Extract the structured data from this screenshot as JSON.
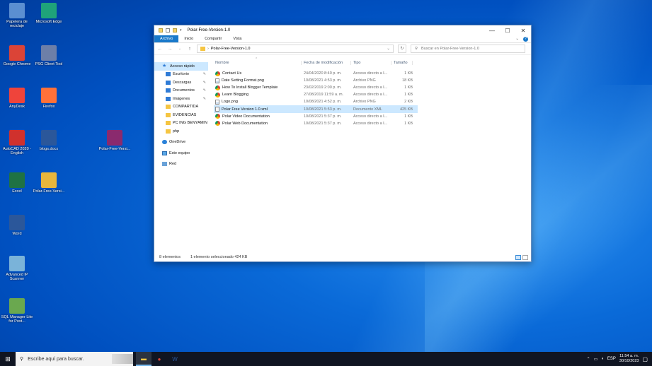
{
  "desktop": {
    "icons": [
      {
        "label": "Papelera de reciclaje",
        "icon": "recycle-bin-icon",
        "color": "#5b8fd1"
      },
      {
        "label": "Microsoft Edge",
        "icon": "edge-icon",
        "color": "#1fa37a"
      },
      {
        "label": "Google Chrome",
        "icon": "chrome-icon",
        "color": "#db4437"
      },
      {
        "label": "PSG Client Tool",
        "icon": "app-icon",
        "color": "#6d7fa8"
      },
      {
        "label": "AnyDesk",
        "icon": "anydesk-icon",
        "color": "#ef443b"
      },
      {
        "label": "Firefox",
        "icon": "firefox-icon",
        "color": "#ff7139"
      },
      {
        "label": "AutoCAD 2020 - English",
        "icon": "autocad-icon",
        "color": "#d0312d"
      },
      {
        "label": "blogs.docx",
        "icon": "word-icon",
        "color": "#2b579a"
      },
      {
        "label": "Polar-Free-Versi...",
        "icon": "winrar-icon",
        "color": "#8a2a6e"
      },
      {
        "label": "Excel",
        "icon": "excel-icon",
        "color": "#1f7244"
      },
      {
        "label": "Polar-Free-Versi...",
        "icon": "zip-folder-icon",
        "color": "#e8b63c"
      },
      {
        "label": "Word",
        "icon": "word-icon",
        "color": "#2b579a"
      },
      {
        "label": "Advanced IP Scanner",
        "icon": "network-icon",
        "color": "#7ab3d9"
      },
      {
        "label": "SQL Manager Lite for Post...",
        "icon": "database-icon",
        "color": "#6aa84f"
      }
    ]
  },
  "window": {
    "title": "Polar-Free-Version-1.0",
    "controls": {
      "minimize": "—",
      "maximize": "☐",
      "close": "✕"
    },
    "ribbon_tabs": [
      "Archivo",
      "Inicio",
      "Compartir",
      "Vista"
    ],
    "address": "Polar-Free-Version-1.0",
    "search_placeholder": "Buscar en Polar-Free-Version-1.0",
    "nav_items": [
      {
        "label": "Acceso rápido",
        "icon": "star-icon",
        "kind": "star",
        "pinned": false
      },
      {
        "label": "Escritorio",
        "icon": "desktop-folder-icon",
        "kind": "blue",
        "pinned": true
      },
      {
        "label": "Descargas",
        "icon": "downloads-icon",
        "kind": "blue",
        "pinned": true
      },
      {
        "label": "Documentos",
        "icon": "documents-icon",
        "kind": "blue",
        "pinned": true
      },
      {
        "label": "Imágenes",
        "icon": "pictures-icon",
        "kind": "blue",
        "pinned": true
      },
      {
        "label": "COMPARTIDA",
        "icon": "folder-icon",
        "kind": "yellow",
        "pinned": false
      },
      {
        "label": "EVIDENCIAS",
        "icon": "folder-icon",
        "kind": "yellow",
        "pinned": false
      },
      {
        "label": "PC ING BENYAMIN",
        "icon": "folder-icon",
        "kind": "yellow",
        "pinned": false
      },
      {
        "label": "php",
        "icon": "folder-icon",
        "kind": "yellow",
        "pinned": false
      },
      {
        "label": "OneDrive",
        "icon": "onedrive-icon",
        "kind": "cloud",
        "pinned": false
      },
      {
        "label": "Este equipo",
        "icon": "this-pc-icon",
        "kind": "pc",
        "pinned": false
      },
      {
        "label": "Red",
        "icon": "network-icon",
        "kind": "net",
        "pinned": false
      }
    ],
    "columns": {
      "name": "Nombre",
      "date": "Fecha de modificación",
      "type": "Tipo",
      "size": "Tamaño"
    },
    "files": [
      {
        "name": "Contact Us",
        "date": "24/04/2020 8:40 p. m.",
        "type": "Acceso directo a I...",
        "size": "1 KB",
        "icon": "link",
        "selected": false
      },
      {
        "name": "Date Setting Format.png",
        "date": "10/08/2021 4:53 p. m.",
        "type": "Archivo PNG",
        "size": "18 KB",
        "icon": "png",
        "selected": false
      },
      {
        "name": "How To Install Blogger Template",
        "date": "23/02/2019 2:00 p. m.",
        "type": "Acceso directo a I...",
        "size": "1 KB",
        "icon": "link",
        "selected": false
      },
      {
        "name": "Learn Blogging",
        "date": "27/08/2019 11:59 a. m.",
        "type": "Acceso directo a I...",
        "size": "1 KB",
        "icon": "link",
        "selected": false
      },
      {
        "name": "Logo.png",
        "date": "10/08/2021 4:52 p. m.",
        "type": "Archivo PNG",
        "size": "2 KB",
        "icon": "png",
        "selected": false
      },
      {
        "name": "Polar Free Version 1.0.xml",
        "date": "10/08/2021 5:53 p. m.",
        "type": "Documento XML",
        "size": "425 KB",
        "icon": "xml",
        "selected": true
      },
      {
        "name": "Polar Video Documentation",
        "date": "10/08/2021 5:37 p. m.",
        "type": "Acceso directo a I...",
        "size": "1 KB",
        "icon": "link",
        "selected": false
      },
      {
        "name": "Polar Web Documentation",
        "date": "10/08/2021 5:37 p. m.",
        "type": "Acceso directo a I...",
        "size": "1 KB",
        "icon": "link",
        "selected": false
      }
    ],
    "status": {
      "count": "8 elementos",
      "selection": "1 elemento seleccionado  424 KB"
    }
  },
  "taskbar": {
    "search_placeholder": "Escribe aquí para buscar.",
    "apps": [
      {
        "name": "file-explorer-taskbar",
        "glyph": "▬",
        "color": "#f5c542",
        "active": true
      },
      {
        "name": "chrome-taskbar",
        "glyph": "●",
        "color": "#db4437",
        "active": false
      },
      {
        "name": "word-taskbar",
        "glyph": "W",
        "color": "#2b579a",
        "active": false
      }
    ],
    "language": "ESP",
    "time": "11:54 a. m.",
    "date": "30/10/2023"
  }
}
